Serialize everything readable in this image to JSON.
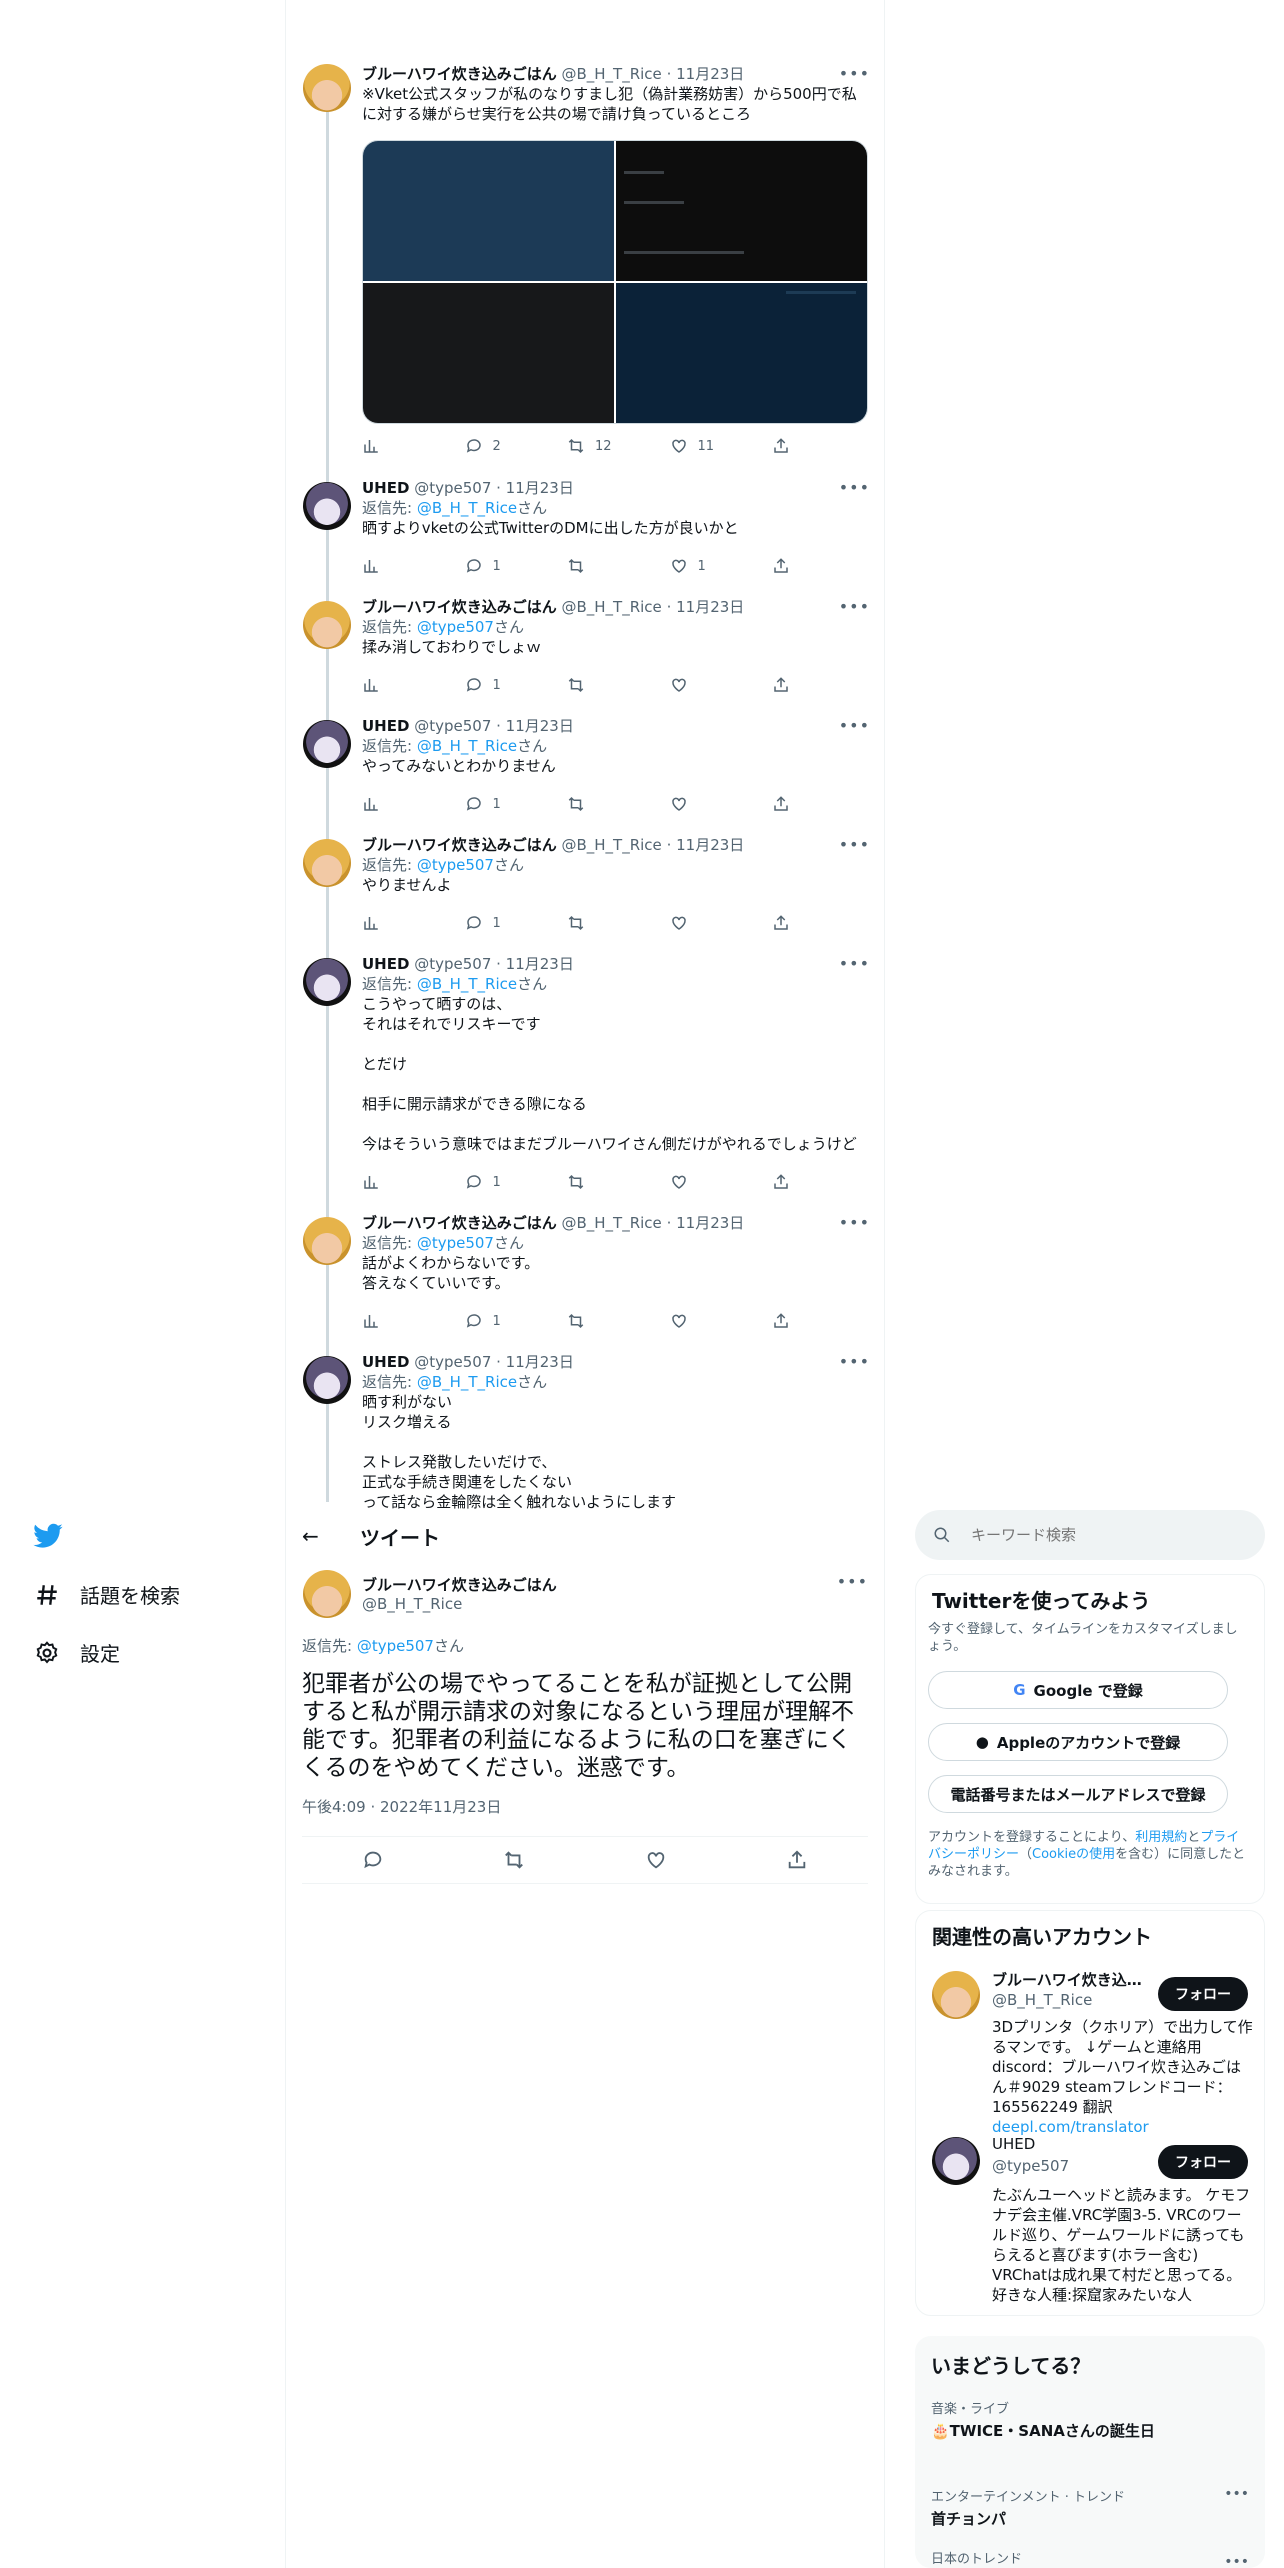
{
  "thread": [
    {
      "author": "ブルーハワイ炊き込みごはん",
      "handle": "@B_H_T_Rice",
      "date": "11月23日",
      "reply_to": "",
      "reply_handle": "",
      "reply_suffix": "",
      "text": "※Vket公式スタッフが私のなりすまし犯（偽計業務妨害）から500円で私に対する嫌がらせ実行を公共の場で請け負っているところ",
      "stats": {
        "views": "",
        "replies": "2",
        "retweets": "12",
        "likes": "11"
      }
    },
    {
      "author": "UHED",
      "handle": "@type507",
      "date": "11月23日",
      "reply_to": "返信先: ",
      "reply_handle": "@B_H_T_Rice",
      "reply_suffix": "さん",
      "text": "晒すよりvketの公式TwitterのDMに出した方が良いかと",
      "stats": {
        "views": "",
        "replies": "1",
        "retweets": "",
        "likes": "1"
      }
    },
    {
      "author": "ブルーハワイ炊き込みごはん",
      "handle": "@B_H_T_Rice",
      "date": "11月23日",
      "reply_to": "返信先: ",
      "reply_handle": "@type507",
      "reply_suffix": "さん",
      "text": "揉み消しておわりでしょｗ",
      "stats": {
        "views": "",
        "replies": "1",
        "retweets": "",
        "likes": ""
      }
    },
    {
      "author": "UHED",
      "handle": "@type507",
      "date": "11月23日",
      "reply_to": "返信先: ",
      "reply_handle": "@B_H_T_Rice",
      "reply_suffix": "さん",
      "text": "やってみないとわかりません",
      "stats": {
        "views": "",
        "replies": "1",
        "retweets": "",
        "likes": ""
      }
    },
    {
      "author": "ブルーハワイ炊き込みごはん",
      "handle": "@B_H_T_Rice",
      "date": "11月23日",
      "reply_to": "返信先: ",
      "reply_handle": "@type507",
      "reply_suffix": "さん",
      "text": "やりませんよ",
      "stats": {
        "views": "",
        "replies": "1",
        "retweets": "",
        "likes": ""
      }
    },
    {
      "author": "UHED",
      "handle": "@type507",
      "date": "11月23日",
      "reply_to": "返信先: ",
      "reply_handle": "@B_H_T_Rice",
      "reply_suffix": "さん",
      "text": "こうやって晒すのは、\nそれはそれでリスキーです\n\nとだけ\n\n相手に開示請求ができる隙になる\n\n今はそういう意味ではまだブルーハワイさん側だけがやれるでしょうけど",
      "stats": {
        "views": "",
        "replies": "1",
        "retweets": "",
        "likes": ""
      }
    },
    {
      "author": "ブルーハワイ炊き込みごはん",
      "handle": "@B_H_T_Rice",
      "date": "11月23日",
      "reply_to": "返信先: ",
      "reply_handle": "@type507",
      "reply_suffix": "さん",
      "text": "話がよくわからないです。\n答えなくていいです。",
      "stats": {
        "views": "",
        "replies": "1",
        "retweets": "",
        "likes": ""
      }
    },
    {
      "author": "UHED",
      "handle": "@type507",
      "date": "11月23日",
      "reply_to": "返信先: ",
      "reply_handle": "@B_H_T_Rice",
      "reply_suffix": "さん",
      "text": "晒す利がない\nリスク増える\n\nストレス発散したいだけで、\n正式な手続き関連をしたくない\nって話なら金輪際は全く触れないようにします",
      "stats": {
        "views": "",
        "replies": "",
        "retweets": "",
        "likes": ""
      }
    }
  ],
  "header": {
    "back": "←",
    "title": "ツイート"
  },
  "main_tweet": {
    "author": "ブルーハワイ炊き込みごはん",
    "handle": "@B_H_T_Rice",
    "reply_to": "返信先: ",
    "reply_handle": "@type507",
    "reply_suffix": "さん",
    "text": "犯罪者が公の場でやってることを私が証拠として公開すると私が開示請求の対象になるという理屈が理解不能です。犯罪者の利益になるように私の口を塞ぎにくくるのをやめてください。迷惑です。",
    "timestamp": "午後4:09 · 2022年11月23日"
  },
  "nav": {
    "explore": "話題を検索",
    "settings": "設定"
  },
  "search": {
    "placeholder": "キーワード検索"
  },
  "signup": {
    "title": "Twitterを使ってみよう",
    "subtitle": "今すぐ登録して、タイムラインをカスタマイズしましょう。",
    "google": "Google で登録",
    "apple": "Appleのアカウントで登録",
    "phone": "電話番号またはメールアドレスで登録",
    "legal_prefix": "アカウントを登録することにより、",
    "terms": "利用規約",
    "and": "と",
    "privacy": "プライバシーポリシー",
    "cookie_open": "（",
    "cookie": "Cookieの使用",
    "legal_suffix": "を含む）に同意したとみなされます。"
  },
  "relevant": {
    "title": "関連性の高いアカウント",
    "follow_label": "フォロー",
    "accounts": [
      {
        "name": "ブルーハワイ炊き込みごはん",
        "handle": "@B_H_T_Rice",
        "bio": "3Dプリンタ（クホリア）で出力して作るマンです。 ↓ゲームと連絡用 discord：ブルーハワイ炊き込みごはん＃9029 steamフレンドコード：165562249 翻訳 ",
        "link": "deepl.com/translator"
      },
      {
        "name": "UHED",
        "handle": "@type507",
        "bio": "たぶんユーヘッドと読みます。 ケモフナデ会主催.VRC学園3-5. VRCのワールド巡り、ゲームワールドに誘ってもらえると喜びます(ホラー含む) VRChatは成れ果て村だと思ってる。好きな人種:探窟家みたいな人",
        "link": ""
      }
    ]
  },
  "trends": {
    "title": "いまどうしてる？",
    "items": [
      {
        "category": "音楽・ライブ",
        "name": "🎂TWICE・SANAさんの誕生日"
      },
      {
        "category": "エンターテインメント · トレンド",
        "name": "首チョンパ"
      },
      {
        "category": "日本のトレンド",
        "name": ""
      }
    ]
  },
  "colors": {
    "accent": "#1d9bf0",
    "text": "#0f1419",
    "secondary": "#536471"
  }
}
